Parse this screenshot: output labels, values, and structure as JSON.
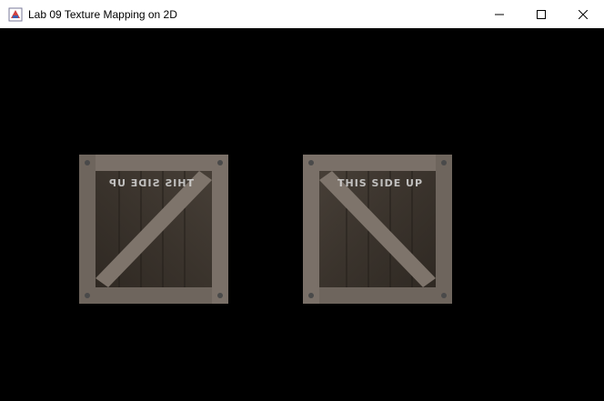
{
  "window": {
    "title": "Lab 09 Texture Mapping on 2D",
    "icons": {
      "app": "java-app-icon",
      "minimize": "minimize-icon",
      "maximize": "maximize-icon",
      "close": "close-icon"
    }
  },
  "canvas": {
    "background": "#000000",
    "crates": [
      {
        "text": "THIS SIDE UP",
        "orientation": "mirrored"
      },
      {
        "text": "THIS SIDE UP",
        "orientation": "normal"
      }
    ]
  },
  "colors": {
    "wood_dark": "#3a332c",
    "wood_mid": "#6b625a",
    "wood_light": "#8a8178",
    "text_paint": "#d8d8d8"
  }
}
